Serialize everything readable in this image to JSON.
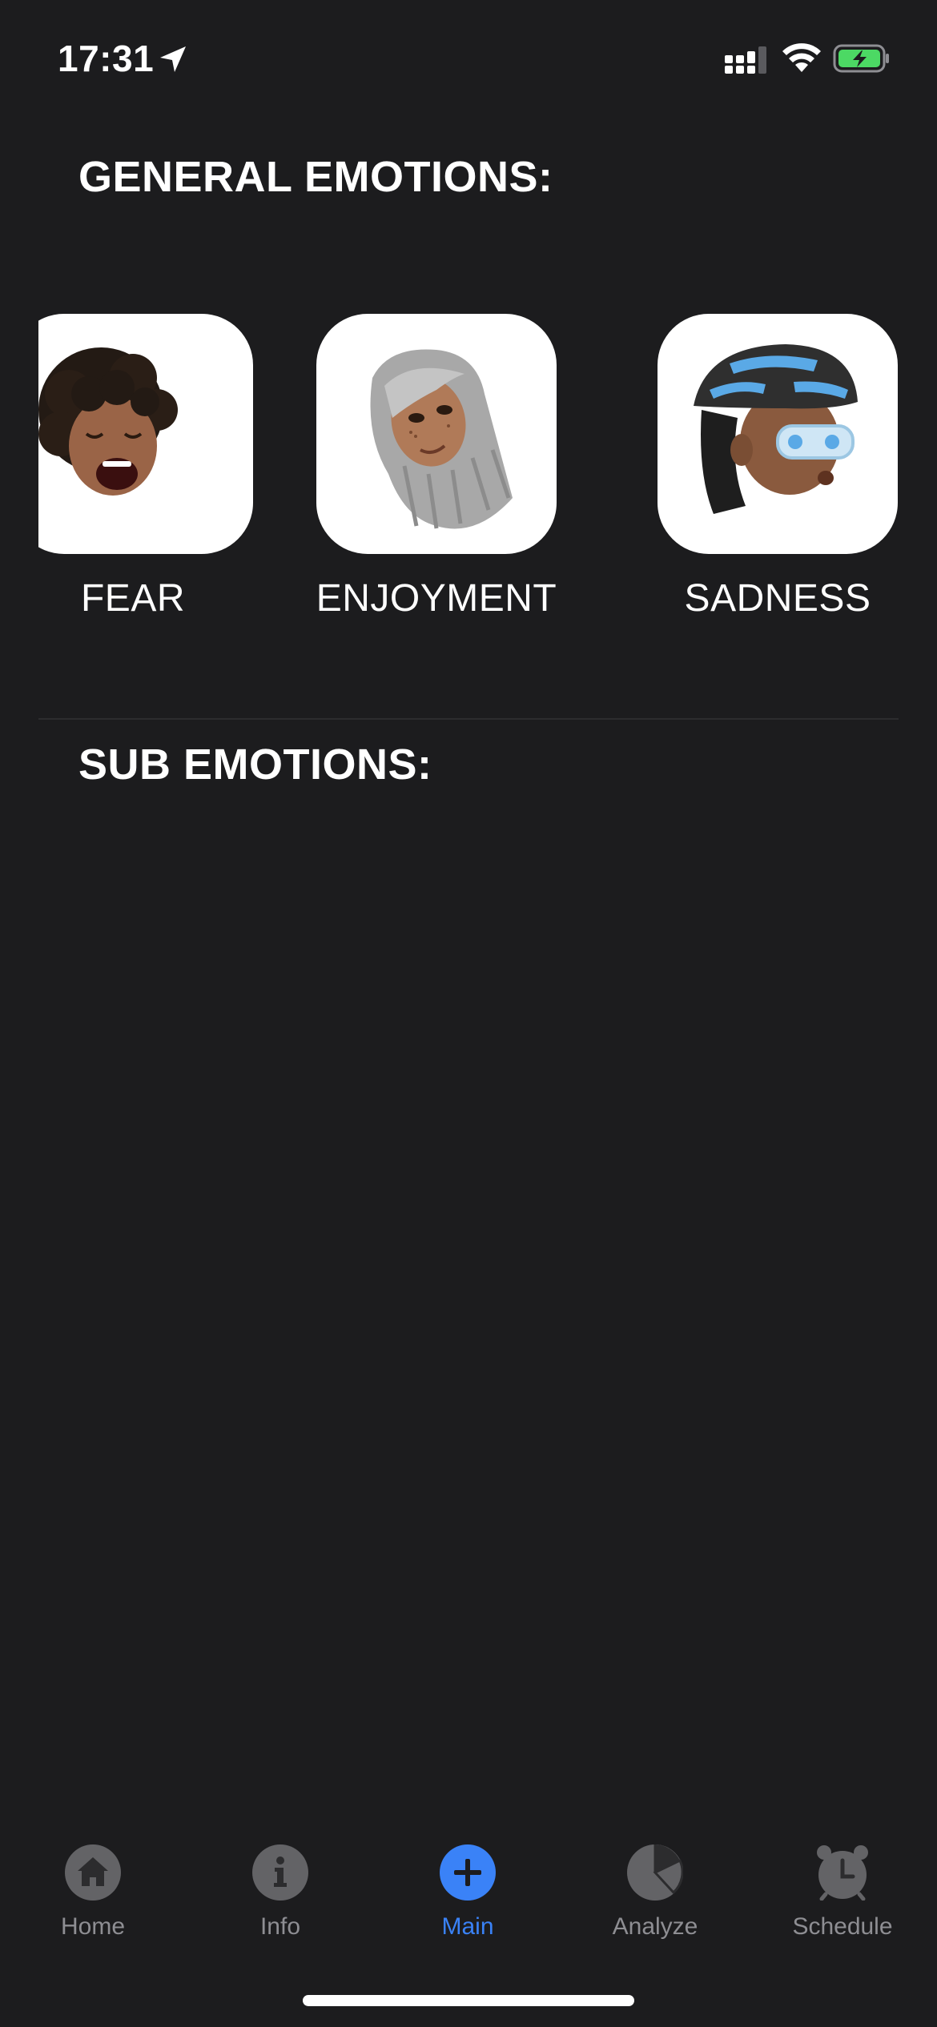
{
  "status_bar": {
    "time": "17:31",
    "icons": [
      "location-arrow-icon",
      "cellular-signal-icon",
      "wifi-icon",
      "battery-charging-icon"
    ],
    "battery_color": "#4cd964"
  },
  "general_section": {
    "title": "GENERAL EMOTIONS:"
  },
  "emotions": [
    {
      "label": "FEAR",
      "avatar": "memoji-screaming-avatar"
    },
    {
      "label": "ENJOYMENT",
      "avatar": "memoji-smiling-avatar"
    },
    {
      "label": "SADNESS",
      "avatar": "memoji-helmet-avatar"
    }
  ],
  "sub_section": {
    "title": "SUB EMOTIONS:"
  },
  "tab_bar": {
    "items": [
      {
        "label": "Home",
        "icon": "house-icon",
        "active": false
      },
      {
        "label": "Info",
        "icon": "info-icon",
        "active": false
      },
      {
        "label": "Main",
        "icon": "plus-icon",
        "active": true
      },
      {
        "label": "Analyze",
        "icon": "pie-chart-icon",
        "active": false
      },
      {
        "label": "Schedule",
        "icon": "alarm-clock-icon",
        "active": false
      }
    ],
    "active_color": "#3a82f7",
    "inactive_color": "#8e8e93"
  },
  "theme": {
    "background": "#1c1c1e",
    "tile_background": "#ffffff"
  }
}
